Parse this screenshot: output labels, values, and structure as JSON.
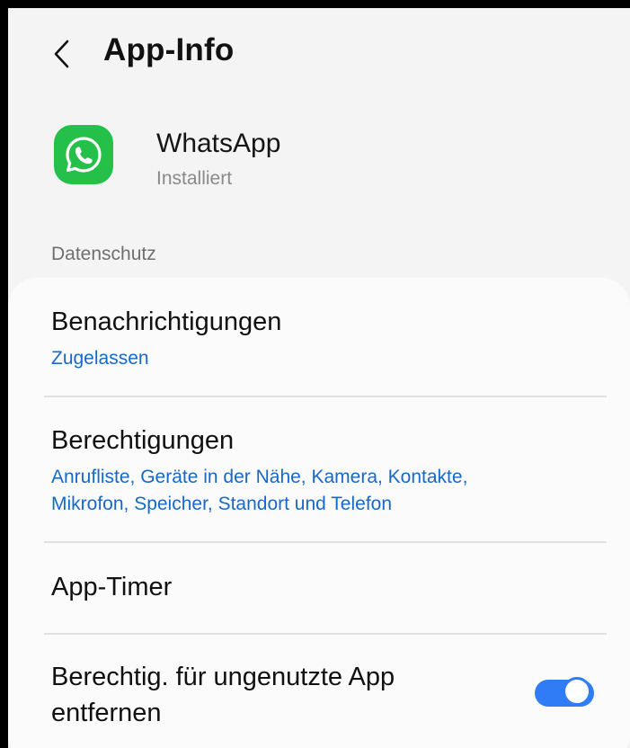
{
  "header": {
    "title": "App-Info",
    "back_icon": "chevron-left-icon"
  },
  "app": {
    "name": "WhatsApp",
    "status": "Installiert",
    "icon": "whatsapp-logo-icon",
    "icon_color": "#25c04a"
  },
  "section": {
    "label": "Datenschutz"
  },
  "settings": {
    "notifications": {
      "title": "Benachrichtigungen",
      "value": "Zugelassen"
    },
    "permissions": {
      "title": "Berechtigungen",
      "value_line1": "Anrufliste, Geräte in der Nähe, Kamera, Kontakte,",
      "value_line2": "Mikrofon, Speicher, Standort und Telefon"
    },
    "app_timer": {
      "title": "App-Timer"
    },
    "remove_permissions": {
      "title_line1": "Berechtig. für ungenutzte App",
      "title_line2": "entfernen",
      "enabled": true
    }
  },
  "colors": {
    "accent": "#2f7cf6",
    "link": "#1769c9",
    "background": "#f4f4f4",
    "card": "#fbfbfb"
  }
}
